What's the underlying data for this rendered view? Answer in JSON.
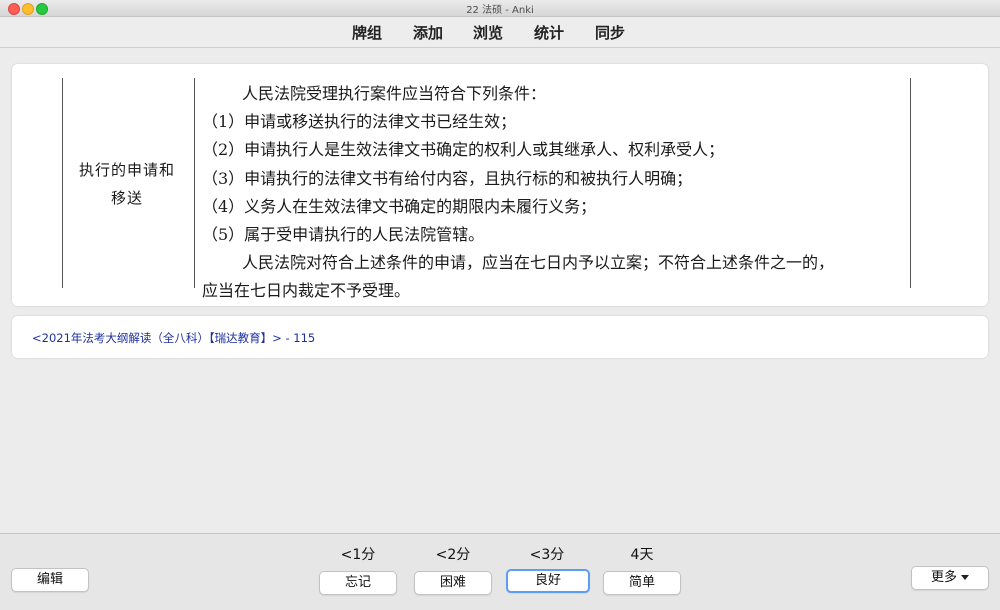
{
  "window": {
    "title": "22 法硕 - Anki"
  },
  "toolbar": {
    "items": [
      "牌组",
      "添加",
      "浏览",
      "统计",
      "同步"
    ]
  },
  "card": {
    "category_line1": "执行的申请和",
    "category_line2": "移送",
    "lines": [
      "人民法院受理执行案件应当符合下列条件：",
      "（1）申请或移送执行的法律文书已经生效；",
      "（2）申请执行人是生效法律文书确定的权利人或其继承人、权利承受人；",
      "（3）申请执行的法律文书有给付内容，且执行标的和被执行人明确；",
      "（4）义务人在生效法律文书确定的期限内未履行义务；",
      "（5）属于受申请执行的人民法院管辖。",
      "人民法院对符合上述条件的申请，应当在七日内予以立案；不符合上述条件之一的，",
      "应当在七日内裁定不予受理。"
    ]
  },
  "source": {
    "text": "<2021年法考大纲解读（全八科）【瑞达教育】> - 115"
  },
  "bottom": {
    "edit_label": "编辑",
    "more_label": "更多",
    "answers": [
      {
        "interval": "<1分",
        "label": "忘记"
      },
      {
        "interval": "<2分",
        "label": "困难"
      },
      {
        "interval": "<3分",
        "label": "良好"
      },
      {
        "interval": "4天",
        "label": "简单"
      }
    ]
  },
  "colors": {
    "link": "#1d2f9e",
    "focus_ring": "#5b9ef4",
    "background": "#ececec"
  }
}
